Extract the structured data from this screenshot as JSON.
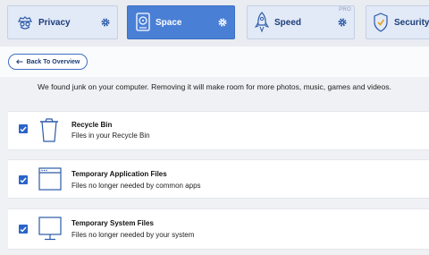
{
  "tabs": [
    {
      "label": "Privacy",
      "active": false
    },
    {
      "label": "Space",
      "active": true
    },
    {
      "label": "Speed",
      "active": false,
      "badge": "PRO"
    },
    {
      "label": "Security",
      "active": false
    }
  ],
  "back_button": {
    "label": "Back To Overview"
  },
  "intro_text": "We found junk on your computer. Removing it will make room for more photos, music, games and videos.",
  "items": [
    {
      "title": "Recycle Bin",
      "description": "Files in your Recycle Bin",
      "checked": true,
      "icon": "trash-icon"
    },
    {
      "title": "Temporary Application Files",
      "description": "Files no longer needed by common apps",
      "checked": true,
      "icon": "app-window-icon"
    },
    {
      "title": "Temporary System Files",
      "description": "Files no longer needed by your system",
      "checked": true,
      "icon": "monitor-icon"
    }
  ],
  "colors": {
    "accent": "#4a7fd6",
    "checkbox": "#2a64c9",
    "text_dark": "#1b3d7a"
  }
}
